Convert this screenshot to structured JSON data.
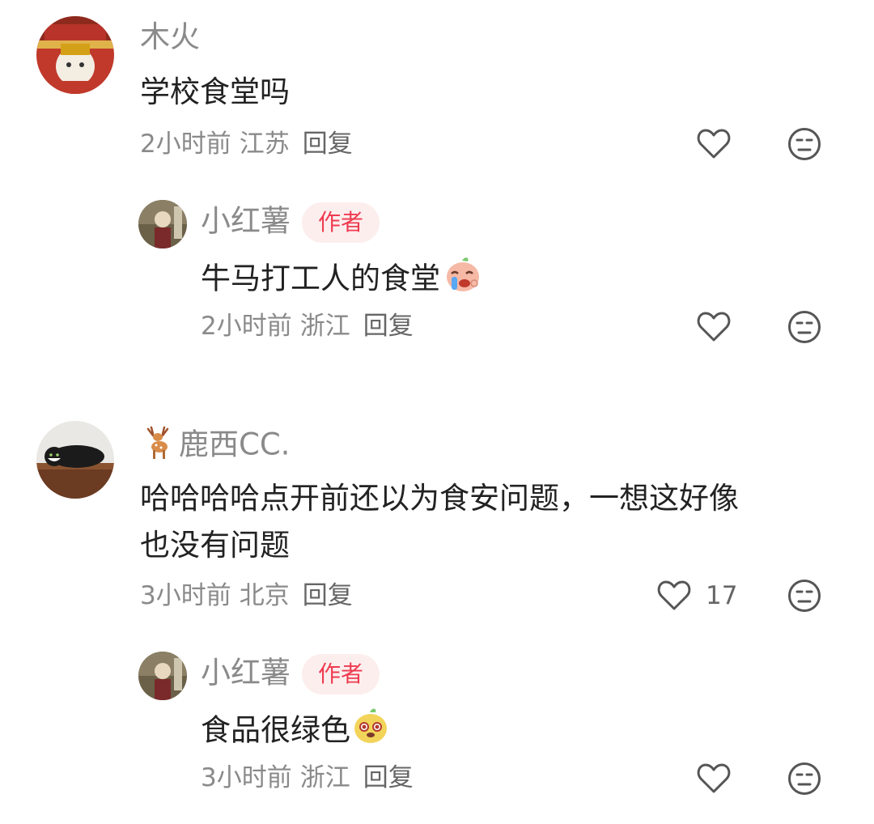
{
  "comments": [
    {
      "username": "木火",
      "content": "学校食堂吗",
      "time": "2小时前",
      "location": "江苏",
      "reply_label": "回复",
      "like_count": "",
      "replies": [
        {
          "username": "小红薯",
          "badge": "作者",
          "content": "牛马打工人的食堂",
          "emoji": "crying-potato-emoji",
          "time": "2小时前",
          "location": "浙江",
          "reply_label": "回复"
        }
      ]
    },
    {
      "username_icon": "deer-emoji",
      "username": "鹿西CC.",
      "content_line1": "哈哈哈哈点开前还以为食安问题，一想这好像",
      "content_line2": "也没有问题",
      "time": "3小时前",
      "location": "北京",
      "reply_label": "回复",
      "like_count": "17",
      "replies": [
        {
          "username": "小红薯",
          "badge": "作者",
          "content": "食品很绿色",
          "emoji": "cute-potato-emoji",
          "time": "3小时前",
          "location": "浙江",
          "reply_label": "回复"
        }
      ]
    }
  ],
  "colors": {
    "badge_bg": "#fdeeee",
    "badge_text": "#ee3b50",
    "meta": "#8a8a8a",
    "text": "#222222"
  }
}
